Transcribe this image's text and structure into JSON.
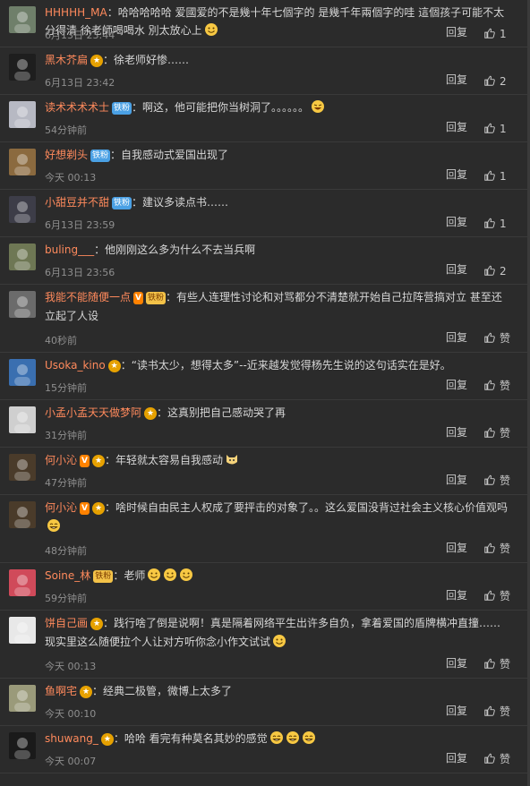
{
  "labels": {
    "reply": "回复",
    "like": "赞"
  },
  "comments": [
    {
      "user": "HHHHH_MA",
      "badges": [],
      "text": "：哈哈哈哈哈 爱國爱的不是幾十年七個字的 是幾千年兩個字的哇 這個孩子可能不太分得清 徐老師喝喝水 別太放心上",
      "emojis": [
        "smile"
      ],
      "time": "6月13日 23:44",
      "likes": "1",
      "avatar": "#6f7f6a"
    },
    {
      "user": "黑木芥扁",
      "badges": [
        "vip"
      ],
      "text": "：徐老师好惨……",
      "emojis": [],
      "time": "6月13日 23:42",
      "likes": "2",
      "avatar": "#1e1e1e"
    },
    {
      "user": "读术术术术士",
      "badges": [
        "fan"
      ],
      "text": "：啊这，他可能把你当树洞了。。。。。。",
      "emojis": [
        "laugh"
      ],
      "time": "54分钟前",
      "likes": "1",
      "avatar": "#b7b9c3"
    },
    {
      "user": "好想剃头",
      "badges": [
        "fan"
      ],
      "text": "：自我感动式爱国出现了",
      "emojis": [],
      "time": "今天 00:13",
      "likes": "1",
      "avatar": "#8b6a3f"
    },
    {
      "user": "小甜豆并不甜",
      "badges": [
        "fan"
      ],
      "text": "：建议多读点书……",
      "emojis": [],
      "time": "6月13日 23:59",
      "likes": "1",
      "avatar": "#3d3d48"
    },
    {
      "user": "buling___",
      "badges": [],
      "text": "：他刚刚这么多为什么不去当兵啊",
      "emojis": [],
      "time": "6月13日 23:56",
      "likes": "2",
      "avatar": "#6e7754"
    },
    {
      "user": "我能不能随便一点",
      "badges": [
        "v",
        "crown"
      ],
      "text": "：有些人连理性讨论和对骂都分不清楚就开始自己拉阵营搞对立 甚至还立起了人设",
      "emojis": [],
      "time": "40秒前",
      "likes": "赞",
      "avatar": "#6b6b6b",
      "tall": true
    },
    {
      "user": "Usoka_kino",
      "badges": [
        "vip"
      ],
      "text": "：“读书太少，想得太多”--近来越发觉得杨先生说的这句话实在是好。",
      "emojis": [],
      "time": "15分钟前",
      "likes": "赞",
      "avatar": "#3a6fb0"
    },
    {
      "user": "小孟小孟天天做梦阿",
      "badges": [
        "vip"
      ],
      "text": "：这真别把自己感动哭了再",
      "emojis": [],
      "time": "31分钟前",
      "likes": "赞",
      "avatar": "#cfcfcf"
    },
    {
      "user": "何小沁",
      "badges": [
        "v",
        "vip"
      ],
      "text": "：年轻就太容易自我感动",
      "emojis": [
        "cat"
      ],
      "time": "47分钟前",
      "likes": "赞",
      "avatar": "#4a3b2a"
    },
    {
      "user": "何小沁",
      "badges": [
        "v",
        "vip"
      ],
      "text": "：啥时候自由民主人权成了要抨击的对象了。。这么爱国没背过社会主义核心价值观吗",
      "emojis": [
        "grin"
      ],
      "time": "48分钟前",
      "likes": "赞",
      "avatar": "#4a3b2a",
      "tall": true
    },
    {
      "user": "Soine_林",
      "badges": [
        "crown"
      ],
      "text": "：老师",
      "emojis": [
        "smile",
        "smile",
        "smile"
      ],
      "time": "59分钟前",
      "likes": "赞",
      "avatar": "#d04a5a"
    },
    {
      "user": "饼自己画",
      "badges": [
        "vip"
      ],
      "text": "：践行啥了倒是说啊！真是隔着网络平生出许多自负，拿着爱国的盾牌横冲直撞……现实里这么随便拉个人让对方听你念小作文试试",
      "emojis": [
        "smile"
      ],
      "time": "今天 00:13",
      "likes": "赞",
      "avatar": "#e8e8e8",
      "tall": true
    },
    {
      "user": "鱼啊宅",
      "badges": [
        "vip"
      ],
      "text": "：经典二极管，微博上太多了",
      "emojis": [],
      "time": "今天 00:10",
      "likes": "赞",
      "avatar": "#9a9a7a"
    },
    {
      "user": "shuwang_",
      "badges": [
        "vip"
      ],
      "text": "：哈哈 看完有种莫名其妙的感觉",
      "emojis": [
        "grin",
        "grin",
        "grin"
      ],
      "time": "今天 00:07",
      "likes": "赞",
      "avatar": "#1a1a1a"
    }
  ],
  "colors": {
    "background": "#2b2b2b",
    "username": "#ff8a5c",
    "fan_badge": "#4aa0e4",
    "vip_badge": "#e6a100",
    "v_badge": "#ff8200"
  },
  "icons": {
    "like": "thumbs-up-icon",
    "fan_badge_text": "铁粉"
  }
}
